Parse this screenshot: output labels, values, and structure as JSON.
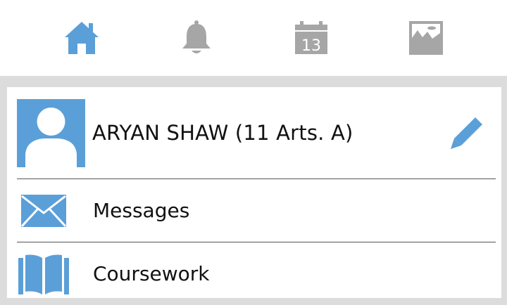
{
  "nav": {
    "tabs": [
      {
        "id": "home",
        "icon": "home-icon",
        "active": true
      },
      {
        "id": "notifications",
        "icon": "bell-icon",
        "active": false
      },
      {
        "id": "calendar",
        "icon": "calendar-icon",
        "active": false,
        "calendar_day": "13"
      },
      {
        "id": "gallery",
        "icon": "image-icon",
        "active": false
      }
    ]
  },
  "profile": {
    "name": "ARYAN SHAW (11 Arts. A)",
    "avatar_icon": "person-icon",
    "edit_icon": "pencil-icon"
  },
  "menu": {
    "items": [
      {
        "label": "Messages",
        "icon": "envelope-icon"
      },
      {
        "label": "Coursework",
        "icon": "book-icon"
      }
    ]
  },
  "colors": {
    "accent": "#5b9fd8",
    "inactive_icon": "#a6a6a6",
    "background": "#dcdcdc",
    "text": "#111111"
  }
}
